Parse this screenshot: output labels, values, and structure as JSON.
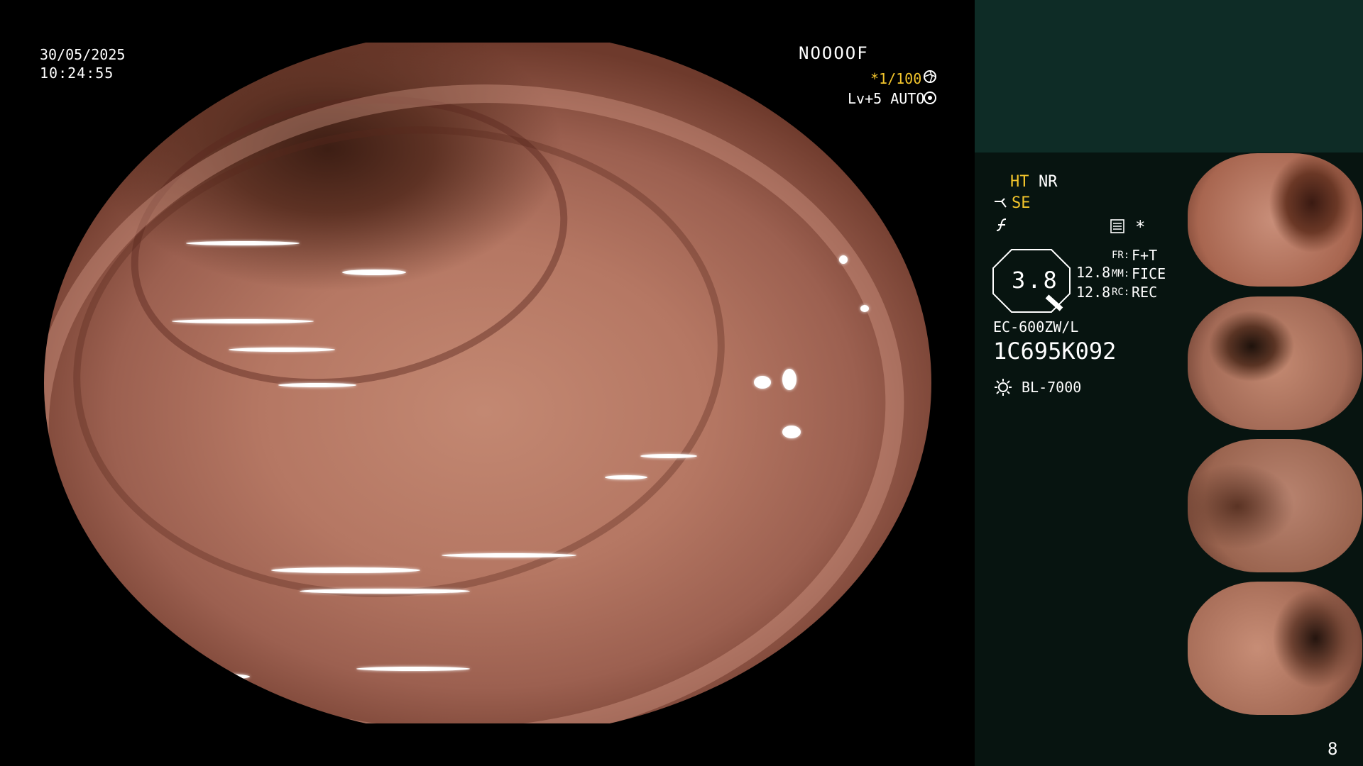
{
  "overlay": {
    "date": "30/05/2025",
    "time": "10:24:55",
    "mode_code": "NOOOOF",
    "shutter": "*1/100",
    "level": "Lv+5 AUTO"
  },
  "settings": {
    "ht_label": "HT",
    "nr_label": "NR",
    "se_label": "SE",
    "zoom_value": "3.8",
    "row1_value": "12.8",
    "row2_value": "12.8",
    "fr_label": "FR:",
    "fr_value": "F+T",
    "mm_label": "MM:",
    "mm_value": "FICE",
    "rc_label": "RC:",
    "rc_value": "REC",
    "scope_model": "EC-600ZW/L",
    "serial": "1C695K092",
    "light_source": "BL-7000"
  },
  "page_number": "8",
  "icons": {
    "shutter_icon": "aperture-icon",
    "auto_icon": "target-icon",
    "se_icon": "scope-bend-icon",
    "f_icon": "f-script-icon",
    "menu_icon": "list-box-icon",
    "star_icon": "asterisk-icon",
    "light_icon": "sun-icon"
  },
  "colors": {
    "accent_yellow": "#f3c52c",
    "panel_dark": "#071410",
    "panel_header": "#0e2c26"
  }
}
